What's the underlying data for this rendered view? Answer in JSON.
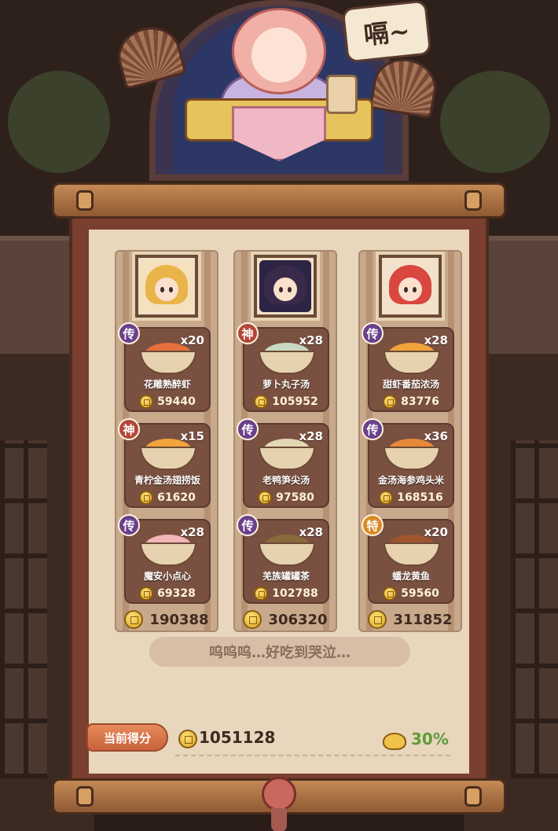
{
  "header": {
    "speech_bubble": "嗝~"
  },
  "columns": [
    {
      "dishes": [
        {
          "tier": "传",
          "tier_color": "#6a3f8c",
          "qty": "x20",
          "name": "花雕熟醉虾",
          "price": "59440",
          "food_color": "#e3703d"
        },
        {
          "tier": "神",
          "tier_color": "#b2473a",
          "qty": "x15",
          "name": "青柠金汤翅捞饭",
          "price": "61620",
          "food_color": "#f0a43a"
        },
        {
          "tier": "传",
          "tier_color": "#6a3f8c",
          "qty": "x28",
          "name": "魔安小点心",
          "price": "69328",
          "food_color": "#f2b5b8"
        }
      ],
      "total": "190388",
      "portrait_hair": "#e9b44a"
    },
    {
      "dishes": [
        {
          "tier": "神",
          "tier_color": "#b2473a",
          "qty": "x28",
          "name": "萝卜丸子汤",
          "price": "105952",
          "food_color": "#c9d8c2"
        },
        {
          "tier": "传",
          "tier_color": "#6a3f8c",
          "qty": "x28",
          "name": "老鸭笋尖汤",
          "price": "97580",
          "food_color": "#e4d7b4"
        },
        {
          "tier": "传",
          "tier_color": "#6a3f8c",
          "qty": "x28",
          "name": "羌族罐罐茶",
          "price": "102788",
          "food_color": "#8a6a3a"
        }
      ],
      "total": "306320",
      "portrait_hair": "#3a2a4a"
    },
    {
      "dishes": [
        {
          "tier": "传",
          "tier_color": "#6a3f8c",
          "qty": "x28",
          "name": "甜虾番茄浓汤",
          "price": "83776",
          "food_color": "#f2a23a"
        },
        {
          "tier": "传",
          "tier_color": "#6a3f8c",
          "qty": "x36",
          "name": "金汤海参鸡头米",
          "price": "168516",
          "food_color": "#e8893a"
        },
        {
          "tier": "特",
          "tier_color": "#d98a25",
          "qty": "x20",
          "name": "蟠龙黄鱼",
          "price": "59560",
          "food_color": "#a0552e"
        }
      ],
      "total": "311852",
      "portrait_hair": "#d9473e"
    }
  ],
  "quote": "呜呜呜…好吃到哭泣…",
  "score": {
    "label": "当前得分",
    "value": "1051128",
    "bonus": "30%"
  },
  "colors": {
    "accent_orange": "#e88b5c",
    "bonus_green": "#5f9b3a",
    "paper": "#e8d6bd",
    "card": "#7a5040"
  }
}
